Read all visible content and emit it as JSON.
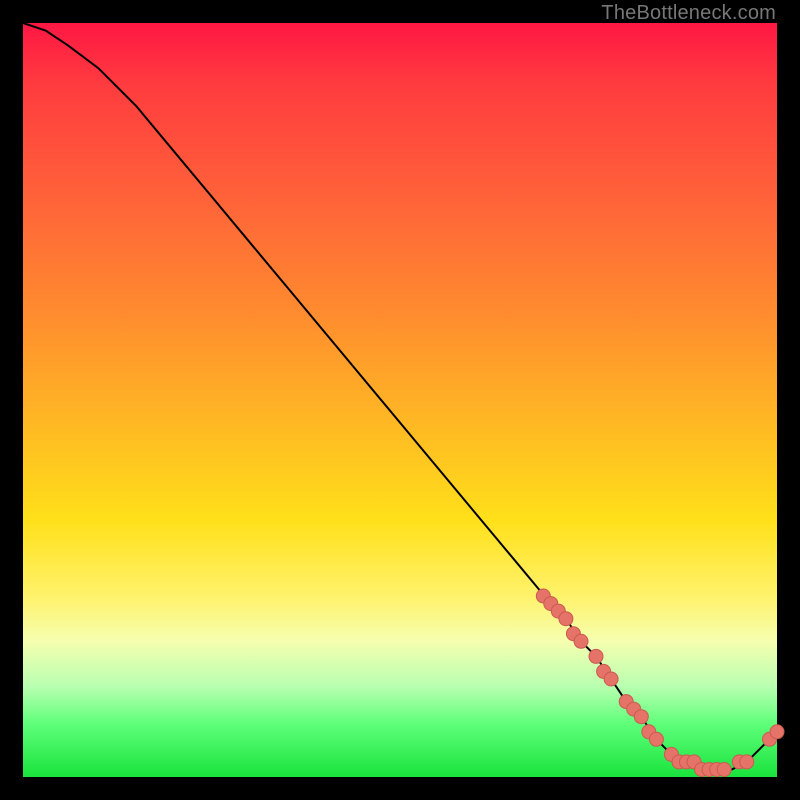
{
  "watermark": "TheBottleneck.com",
  "colors": {
    "curve": "#000000",
    "marker_fill": "#e57368",
    "marker_stroke": "#c95b50"
  },
  "chart_data": {
    "type": "line",
    "title": "",
    "xlabel": "",
    "ylabel": "",
    "xlim": [
      0,
      100
    ],
    "ylim": [
      0,
      100
    ],
    "grid": false,
    "legend": false,
    "series": [
      {
        "name": "bottleneck-curve",
        "x": [
          0,
          3,
          6,
          10,
          15,
          20,
          25,
          30,
          35,
          40,
          45,
          50,
          55,
          60,
          65,
          70,
          72,
          74,
          76,
          78,
          80,
          82,
          84,
          86,
          88,
          90,
          92,
          94,
          96,
          98,
          100
        ],
        "y": [
          100,
          99,
          97,
          94,
          89,
          83,
          77,
          71,
          65,
          59,
          53,
          47,
          41,
          35,
          29,
          23,
          21,
          18,
          16,
          13,
          10,
          8,
          5,
          3,
          2,
          1,
          1,
          1,
          2,
          4,
          6
        ]
      }
    ],
    "markers": [
      {
        "x": 69,
        "y": 24
      },
      {
        "x": 70,
        "y": 23
      },
      {
        "x": 71,
        "y": 22
      },
      {
        "x": 72,
        "y": 21
      },
      {
        "x": 73,
        "y": 19
      },
      {
        "x": 74,
        "y": 18
      },
      {
        "x": 76,
        "y": 16
      },
      {
        "x": 77,
        "y": 14
      },
      {
        "x": 78,
        "y": 13
      },
      {
        "x": 80,
        "y": 10
      },
      {
        "x": 81,
        "y": 9
      },
      {
        "x": 82,
        "y": 8
      },
      {
        "x": 83,
        "y": 6
      },
      {
        "x": 84,
        "y": 5
      },
      {
        "x": 86,
        "y": 3
      },
      {
        "x": 87,
        "y": 2
      },
      {
        "x": 88,
        "y": 2
      },
      {
        "x": 89,
        "y": 2
      },
      {
        "x": 90,
        "y": 1
      },
      {
        "x": 91,
        "y": 1
      },
      {
        "x": 92,
        "y": 1
      },
      {
        "x": 93,
        "y": 1
      },
      {
        "x": 95,
        "y": 2
      },
      {
        "x": 96,
        "y": 2
      },
      {
        "x": 99,
        "y": 5
      },
      {
        "x": 100,
        "y": 6
      }
    ]
  }
}
